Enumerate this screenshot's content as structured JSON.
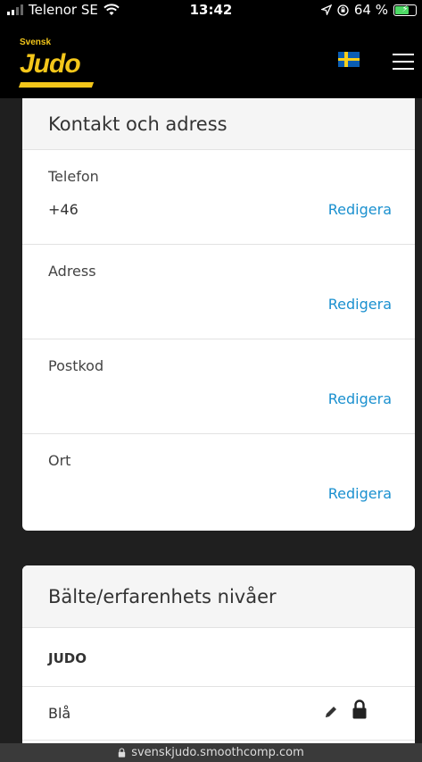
{
  "status_bar": {
    "carrier": "Telenor SE",
    "time": "13:42",
    "battery_text": "64 %",
    "battery_level": 0.64
  },
  "header": {
    "logo_small": "Svensk",
    "logo_big": "Judo",
    "language": "Swedish flag",
    "menu_icon": "hamburger-menu-icon"
  },
  "contact": {
    "title": "Kontakt och adress",
    "rows": [
      {
        "label": "Telefon",
        "value": "+46",
        "link": "Redigera"
      },
      {
        "label": "Adress",
        "value": "",
        "link": "Redigera"
      },
      {
        "label": "Postkod",
        "value": "",
        "link": "Redigera"
      },
      {
        "label": "Ort",
        "value": "",
        "link": "Redigera"
      }
    ]
  },
  "belts": {
    "title": "Bälte/erfarenhets nivåer",
    "section": "JUDO",
    "items": [
      {
        "label": "Blå",
        "edit_icon": "pencil-icon",
        "lock_icon": "lock-icon"
      }
    ]
  },
  "url_bar": {
    "url": "svenskjudo.smoothcomp.com"
  }
}
